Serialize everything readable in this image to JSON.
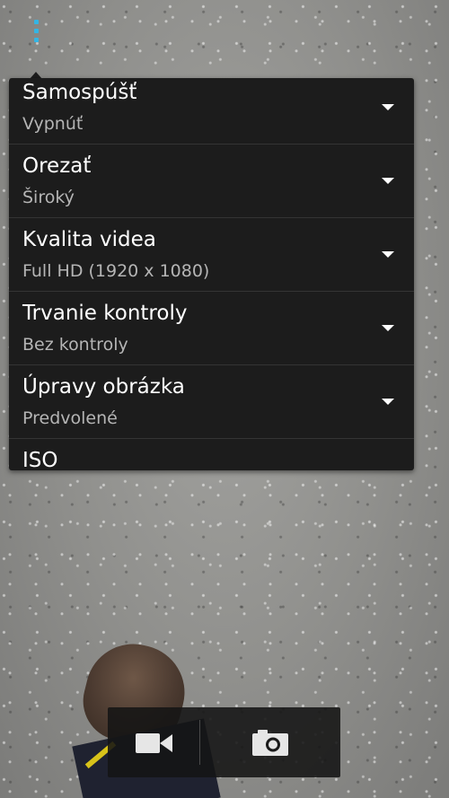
{
  "overflow_menu": {
    "icon": "overflow-menu-icon",
    "color": "#33b5e5"
  },
  "settings": {
    "items": [
      {
        "title": "Samospúšť",
        "value": "Vypnúť"
      },
      {
        "title": "Orezať",
        "value": "Široký"
      },
      {
        "title": "Kvalita videa",
        "value": "Full HD (1920 x 1080)"
      },
      {
        "title": "Trvanie kontroly",
        "value": "Bez kontroly"
      },
      {
        "title": "Úpravy obrázka",
        "value": "Predvolené"
      },
      {
        "title": "ISO",
        "value": ""
      }
    ],
    "dropdown_icon": "dropdown-arrow-icon"
  },
  "capture_bar": {
    "video_icon": "video-camera-icon",
    "photo_icon": "camera-shutter-icon"
  }
}
